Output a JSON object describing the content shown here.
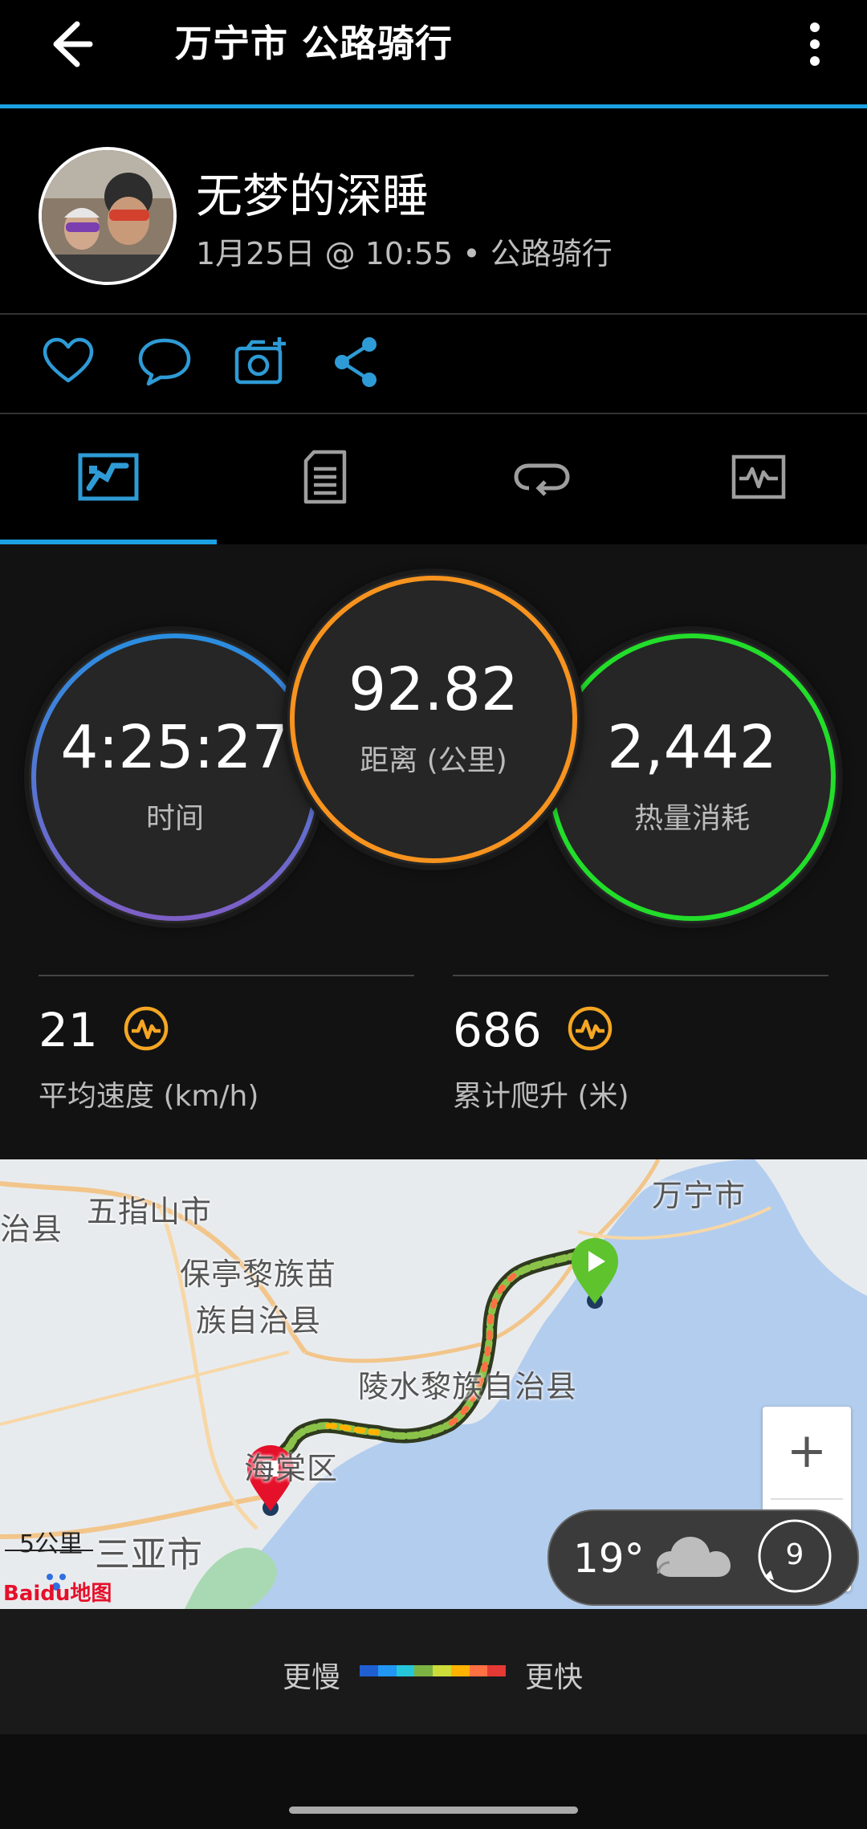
{
  "header": {
    "title": "万宁市 公路骑行"
  },
  "profile": {
    "name": "无梦的深睡",
    "subline": "1月25日 @ 10:55 • 公路骑行"
  },
  "actions": [
    "like-icon",
    "comment-icon",
    "add-photo-icon",
    "share-icon"
  ],
  "tabs": [
    {
      "icon": "stats-icon",
      "active": true
    },
    {
      "icon": "details-icon",
      "active": false
    },
    {
      "icon": "laps-icon",
      "active": false
    },
    {
      "icon": "charts-icon",
      "active": false
    }
  ],
  "stats": {
    "time": {
      "value": "4:25:27",
      "label": "时间"
    },
    "distance": {
      "value": "92.82",
      "label": "距离 (公里)"
    },
    "calories": {
      "value": "2,442",
      "label": "热量消耗"
    },
    "avg_speed": {
      "value": "21",
      "label": "平均速度 (km/h)"
    },
    "ascent": {
      "value": "686",
      "label": "累计爬升 (米)"
    }
  },
  "map": {
    "labels": {
      "wanning": "万宁市",
      "wuzhishan": "五指山市",
      "zhixian": "治县",
      "baoting1": "保亭黎族苗",
      "baoting2": "族自治县",
      "lingshui": "陵水黎族自治县",
      "district": "海棠区",
      "sanya": "三亚市"
    },
    "scale_label": "5公里",
    "logo": "Baidu地图",
    "zoom_in": "+",
    "weather": {
      "temp": "19°",
      "icon": "cloud-icon",
      "wind": "9"
    }
  },
  "legend": {
    "slow": "更慢",
    "fast": "更快",
    "colors": [
      "#1f5fd1",
      "#2196f3",
      "#26c6da",
      "#7cb342",
      "#cddc39",
      "#ffb300",
      "#ff7043",
      "#e53935"
    ]
  }
}
